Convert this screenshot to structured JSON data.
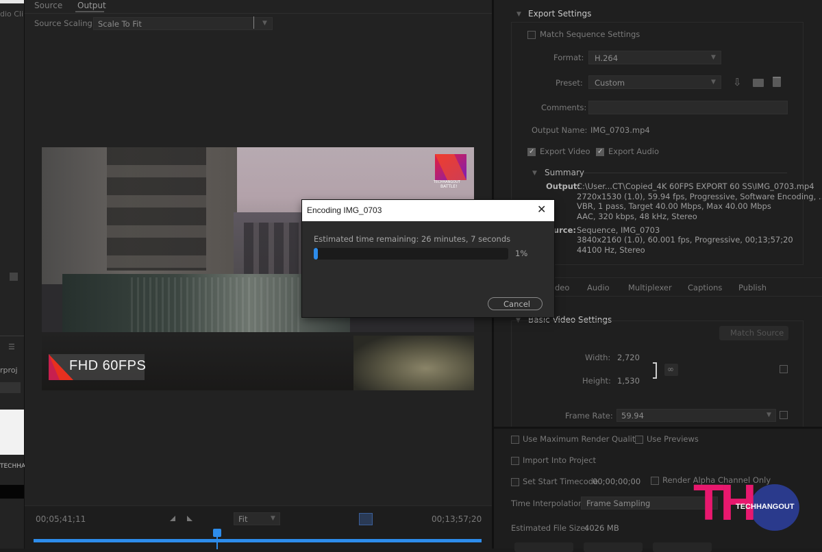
{
  "left_strip": {
    "audio_clip": "dio Cli",
    "project": "rproj",
    "tech": "TECHHA"
  },
  "output_tabs": {
    "source": "Source",
    "output": "Output"
  },
  "scaling": {
    "label": "Source Scaling:",
    "value": "Scale To Fit"
  },
  "preview": {
    "badge_text": "FHD 60FPS",
    "logo_line1": "TECHHANGOUT",
    "logo_line2": "BATTLE!"
  },
  "timeline": {
    "start_tc": "00;05;41;11",
    "end_tc": "00;13;57;20",
    "zoom": "Fit",
    "playhead_fraction": 0.41
  },
  "dialog": {
    "title": "Encoding IMG_0703",
    "status": "Estimated time remaining: 26 minutes, 7 seconds",
    "progress_label": "1%",
    "progress": 0.01,
    "cancel": "Cancel"
  },
  "export_settings": {
    "header": "Export Settings",
    "match_sequence": "Match Sequence Settings",
    "format_label": "Format:",
    "format_value": "H.264",
    "preset_label": "Preset:",
    "preset_value": "Custom",
    "comments_label": "Comments:",
    "output_name_label": "Output Name:",
    "output_name_value": "IMG_0703.mp4",
    "export_video": "Export Video",
    "export_audio": "Export Audio",
    "summary_header": "Summary",
    "output_label": "Output:",
    "output_lines": [
      "C:\\User...CT\\Copied_4K 60FPS EXPORT 60 SS\\IMG_0703.mp4",
      "2720x1530 (1.0), 59.94 fps, Progressive, Software Encoding, ...",
      "VBR, 1 pass, Target 40.00 Mbps, Max 40.00 Mbps",
      "AAC, 320 kbps, 48 kHz, Stereo"
    ],
    "source_label": "ource:",
    "source_lines": [
      "Sequence, IMG_0703",
      "3840x2160 (1.0), 60.001 fps, Progressive, 00;13;57;20",
      "44100 Hz, Stereo"
    ]
  },
  "settings_tabs": {
    "video": "deo",
    "audio": "Audio",
    "multiplexer": "Multiplexer",
    "captions": "Captions",
    "publish": "Publish"
  },
  "basic_video": {
    "header": "Basic Video Settings",
    "match_source": "Match Source",
    "width_label": "Width:",
    "width_value": "2,720",
    "height_label": "Height:",
    "height_value": "1,530",
    "frame_rate_label": "Frame Rate:",
    "frame_rate_value": "59.94"
  },
  "bottom_options": {
    "max_render": "Use Maximum Render Quality",
    "use_previews": "Use Previews",
    "import_project": "Import Into Project",
    "set_start_tc": "Set Start Timecode",
    "start_tc_value": "00;00;00;00",
    "render_alpha": "Render Alpha Channel Only",
    "time_interp_label": "Time Interpolation:",
    "time_interp_value": "Frame Sampling",
    "file_size_label": "Estimated File Size:",
    "file_size_value": "4026 MB"
  },
  "watermark": {
    "letters": "TH",
    "brand": "TECHHANGOUT"
  },
  "colors": {
    "accent_blue": "#2d8ceb",
    "watermark_pink": "#e8186e",
    "watermark_navy": "#2a3a8c"
  }
}
